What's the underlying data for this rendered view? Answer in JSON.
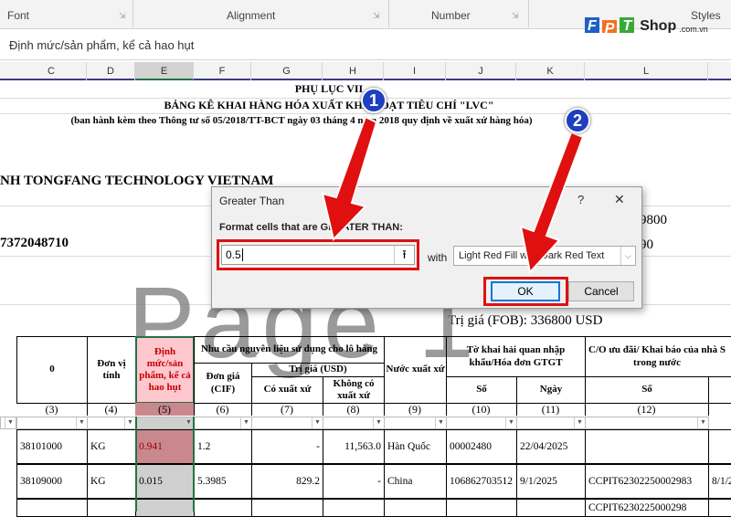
{
  "ribbon": {
    "groups": [
      "Font",
      "Alignment",
      "Number",
      "Styles"
    ]
  },
  "formula_bar": {
    "value": "Định mức/sản phẩm, kể cả hao hụt"
  },
  "logo": {
    "brand": "FPT",
    "site": "Shop",
    "domain": ".com.vn"
  },
  "columns": [
    "C",
    "D",
    "E",
    "F",
    "G",
    "H",
    "I",
    "J",
    "K",
    "L"
  ],
  "sheet": {
    "title1": "PHỤ LỤC VII",
    "title2": "BẢNG KÊ KHAI HÀNG HÓA XUẤT KHẨU ĐẠT TIÊU CHÍ \"LVC\"",
    "title3": "(ban hành kèm theo Thông tư số 05/2018/TT-BCT ngày 03 tháng 4 năm 2018 quy định về xuất xứ hàng hóa)",
    "company": "NH TONGFANG TECHNOLOGY VIETNAM",
    "tax_code": "7372048710",
    "right1": "9800",
    "right2": "90",
    "fob": "Trị giá (FOB): 336800 USD",
    "watermark": "Page 1"
  },
  "table": {
    "headers": {
      "c": "0",
      "d": "Đơn vị tính",
      "e": "Định mức/sản phẩm, kể cả hao hụt",
      "group": "Nhu cầu nguyên liệu sử dụng cho lô hàng",
      "f": "Đơn giá (CIF)",
      "value_group": "Trị giá (USD)",
      "g": "Có xuất xứ",
      "h": "Không có xuất xứ",
      "i": "Nước xuất xứ",
      "jk": "Tờ khai hải quan nhập khẩu/Hóa đơn GTGT",
      "j": "Số",
      "k": "Ngày",
      "l_group": "C/O ưu đãi/ Khai báo của nhà S trong nước",
      "l": "Số"
    },
    "numbers": [
      "(3)",
      "(4)",
      "(5)",
      "(6)",
      "(7)",
      "(8)",
      "(9)",
      "(10)",
      "(11)",
      "(12)"
    ],
    "rows": [
      [
        "38101000",
        "KG",
        "0.941",
        "1.2",
        "-",
        "11,563.0",
        "Hàn Quốc",
        "00002480",
        "22/04/2025",
        "",
        ""
      ],
      [
        "38109000",
        "KG",
        "0.015",
        "5.3985",
        "829.2",
        "-",
        "China",
        "106862703512",
        "9/1/2025",
        "CCPIT62302250002983",
        "8/1/2"
      ],
      [
        "",
        "",
        "",
        "",
        "",
        "",
        "",
        "",
        "",
        "CCPIT6230225000298",
        ""
      ]
    ]
  },
  "dialog": {
    "title": "Greater Than",
    "help": "?",
    "close": "✕",
    "label": "Format cells that are GREATER THAN:",
    "value": "0.5",
    "with": "with",
    "format": "Light Red Fill with Dark Red Text",
    "ok": "OK",
    "cancel": "Cancel"
  },
  "annotations": {
    "step1": "1",
    "step2": "2"
  },
  "colors": {
    "highlight_fill": "#ffc7ce",
    "highlight_text": "#9c0006",
    "arrow": "#e01010",
    "badge": "#1e3fbf"
  }
}
